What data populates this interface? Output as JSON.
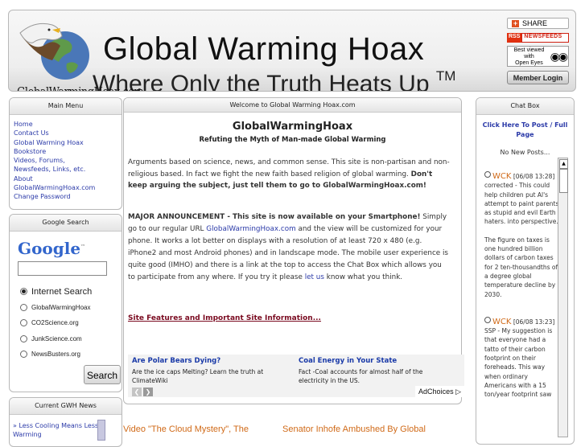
{
  "header": {
    "title": "Global Warming Hoax",
    "tagline": "Where Only the Truth Heats Up",
    "tagline_tm": "TM",
    "domain": "GlobalWarmingHoax.com",
    "share_label": "SHARE",
    "rss_label": "RSS",
    "newsfeeds_label": "NEWSFEEDS",
    "best_viewed": "Best viewed",
    "with_label": "with",
    "open_eyes": "Open Eyes",
    "member_login": "Member Login"
  },
  "main_menu": {
    "title": "Main Menu",
    "items": [
      "Home",
      "Contact Us",
      "Global Warming Hoax",
      "Bookstore",
      "Videos, Forums,",
      "Newsfeeds, Links, etc.",
      "About",
      "GlobalWarmingHoax.com",
      "Change Password"
    ]
  },
  "google_search": {
    "title": "Google Search",
    "logo": "Google",
    "logo_tm": "™",
    "options": [
      "Internet Search",
      "GlobalWarmingHoax",
      "CO2Science.org",
      "JunkScience.com",
      "NewsBusters.org"
    ],
    "button": "Search"
  },
  "news": {
    "title": "Current GWH News",
    "item": "» Less Cooling Means Less Warming"
  },
  "main": {
    "title": "Welcome to Global Warming Hoax.com",
    "site_name": "GlobalWarmingHoax",
    "subtitle": "Refuting the Myth of Man-made Global Warming",
    "para1_text": "Arguments based on science, news, and common sense. This site is non-partisan and non-religious based. In fact we fight the new faith based religion of global warming. ",
    "para1_bold": "Don't keep arguing the subject, just tell them to go to GlobalWarmingHoax.com!",
    "announce_bold": "MAJOR ANNOUNCEMENT - This site is now available on your Smartphone!",
    "announce_text1": " Simply go to our regular URL ",
    "announce_link": "GlobalWarmingHoax.com",
    "announce_text2": " and the view will be customized for your phone. It works a lot better on displays with a resolution of at least 720 x 480 (e.g. iPhone2 and most Android phones) and in landscape mode. The mobile user experience is quite good (IMHO) and there is a link at the top to access the Chat Box which allows you to participate from any where. If you try it please ",
    "let_us": "let us",
    "announce_text3": " know what you think.",
    "features_link": "Site Features and Important Site Information..."
  },
  "ad": {
    "left_head": "Are Polar Bears Dying?",
    "left_body": "Are the ice caps Melting? Learn the truth at ClimateWiki",
    "right_head": "Coal Energy in Your State",
    "right_body": "Fact -Coal accounts for almost half of the electricity in the US.",
    "adchoices": "AdChoices ▷"
  },
  "bottom_links": [
    "Video \"The Cloud Mystery\", The",
    "Senator Inhofe Ambushed By Global"
  ],
  "chat": {
    "title": "Chat Box",
    "link": "Click Here To Post / Full Page",
    "no_new": "No New Posts...",
    "posts": [
      {
        "user": "WCK",
        "date": "[06/08 13:28]",
        "text": "corrected - This could help children put Al's attempt to paint parents as stupid and evil Earth haters. into perspective.",
        "text2": "The figure on taxes is one hundred billion dollars of carbon taxes for 2 ten-thousandths of a degree global temperature decline by 2030."
      },
      {
        "user": "WCK",
        "date": "[06/08 13:23]",
        "text": "SSP - My suggestion is that everyone had a tatto of their carbon footprint on their foreheads. This way when ordinary Americans with a 15 ton/year footprint saw",
        "text2": ""
      }
    ]
  }
}
